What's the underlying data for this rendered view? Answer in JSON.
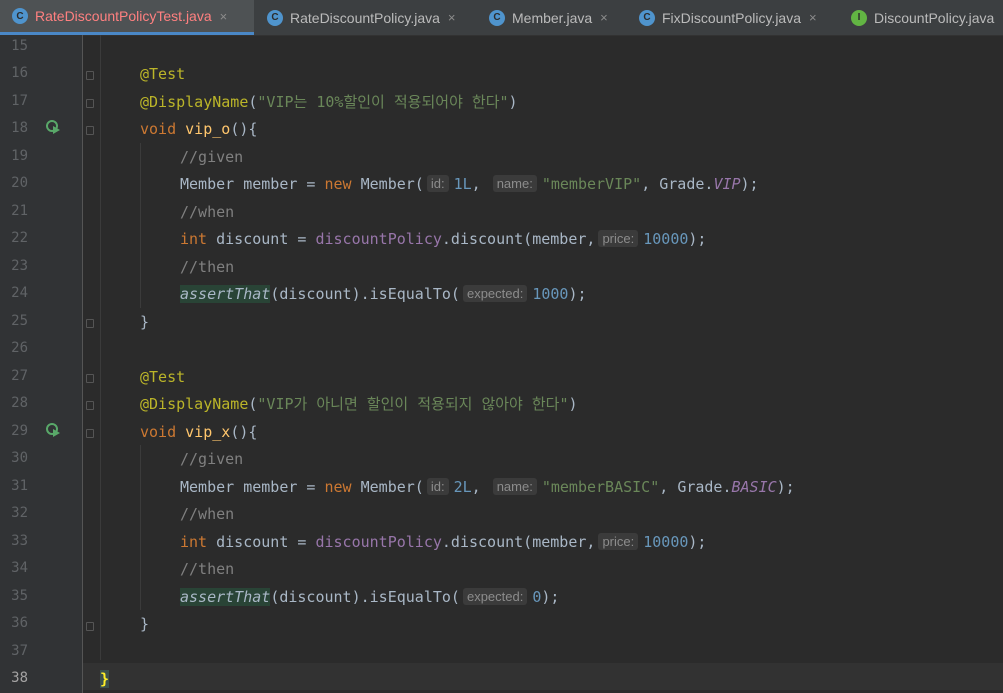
{
  "tabs": [
    {
      "label": "RateDiscountPolicyTest.java",
      "icon": "class-icon",
      "active": true,
      "close": "×"
    },
    {
      "label": "RateDiscountPolicy.java",
      "icon": "class-icon",
      "close": "×"
    },
    {
      "label": "Member.java",
      "icon": "class-icon",
      "close": "×"
    },
    {
      "label": "FixDiscountPolicy.java",
      "icon": "class-icon",
      "close": "×"
    },
    {
      "label": "DiscountPolicy.java",
      "icon": "interface-icon"
    }
  ],
  "icon_letters": {
    "class": "C",
    "interface": "I"
  },
  "colors": {
    "keyword": "#cc7832",
    "annotation": "#bbb529",
    "string": "#6a8759",
    "number": "#6897bb",
    "comment": "#808080",
    "field": "#9876aa",
    "method": "#ffc66d",
    "active_tab_text": "#ff8080"
  },
  "line_numbers": [
    "15",
    "16",
    "17",
    "18",
    "19",
    "20",
    "21",
    "22",
    "23",
    "24",
    "25",
    "26",
    "27",
    "28",
    "29",
    "30",
    "31",
    "32",
    "33",
    "34",
    "35",
    "36",
    "37",
    "38"
  ],
  "code": {
    "ann_test": "@Test",
    "ann_display": "@DisplayName",
    "paren_open": "(",
    "paren_close": ")",
    "paren_semi": ");",
    "display1": "\"VIP는 10%할인이 적용되어야 한다\"",
    "display2": "\"VIP가 아니면 할인이 적용되지 않아야 한다\"",
    "kw_void": "void",
    "kw_new": "new",
    "kw_int": "int",
    "m1": "vip_o",
    "m2": "vip_x",
    "sig_tail": "(){",
    "given": "//given",
    "when": "//when",
    "then": "//then",
    "member_decl": "Member member = ",
    "member_ctor": " Member(",
    "hint_id": "id:",
    "hint_name": "name:",
    "hint_price": "price:",
    "hint_expected": "expected:",
    "id1": "1L",
    "id2": "2L",
    "comma": ", ",
    "str1": "\"memberVIP\"",
    "str2": "\"memberBASIC\"",
    "grade": "Grade.",
    "vip": "VIP",
    "basic": "BASIC",
    "discount_decl": " discount = ",
    "policy_field": "discountPolicy",
    "discount_call": ".discount(member,",
    "price": "10000",
    "assert": "assertThat",
    "assert_mid": "(discount).isEqualTo(",
    "exp1": "1000",
    "exp2": "0",
    "brace_close": "}"
  }
}
